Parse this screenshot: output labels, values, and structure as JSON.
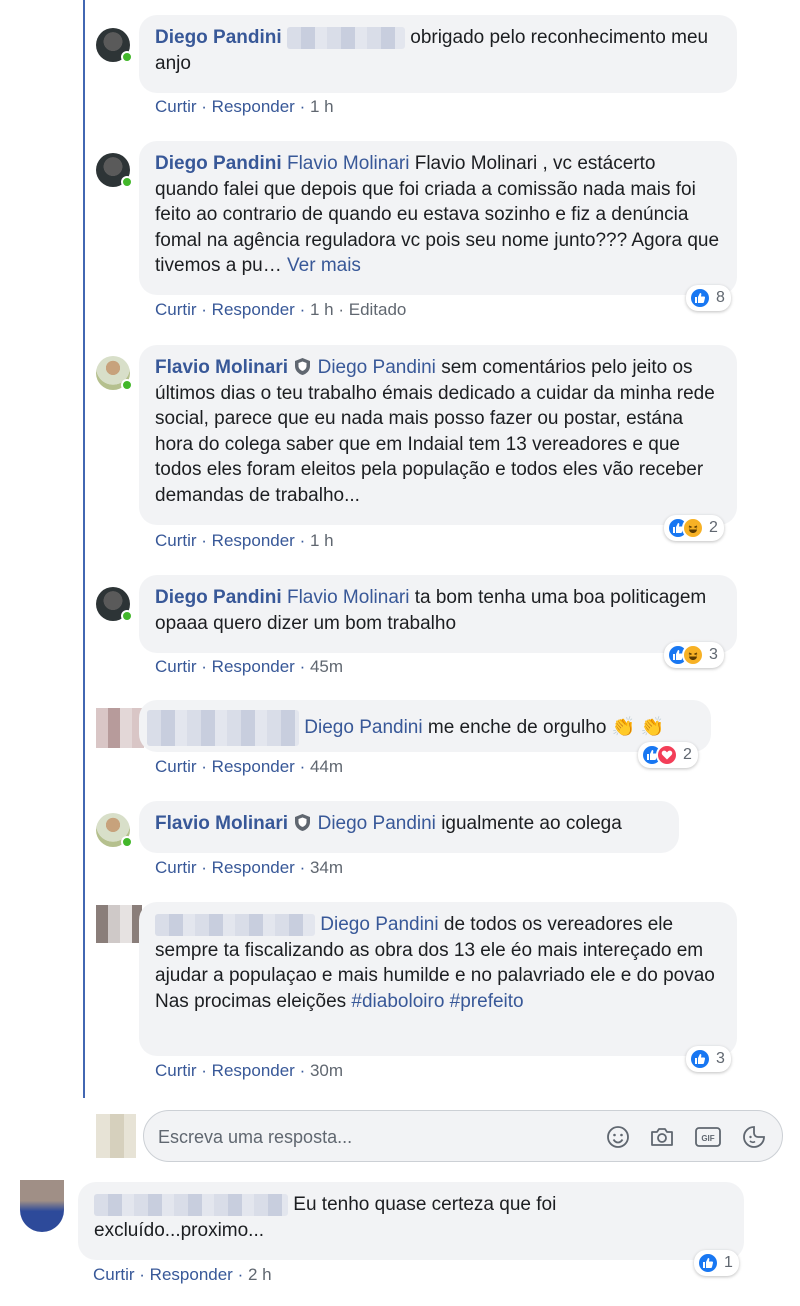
{
  "comments": [
    {
      "author": "Diego Pandini",
      "text": "obrigado pelo reconhecimento meu anjo",
      "actions": {
        "like": "Curtir",
        "reply": "Responder",
        "time": "1 h"
      }
    },
    {
      "author": "Diego Pandini",
      "mention": "Flavio Molinari",
      "text": "Flavio Molinari , vc estácerto quando falei que depois que foi criada a comissão nada mais foi feito ao contrario de quando eu estava sozinho e fiz a denúncia fomal na agência reguladora vc pois seu nome junto??? Agora que tivemos a pu…",
      "see_more": "Ver mais",
      "reactions": "8",
      "actions": {
        "like": "Curtir",
        "reply": "Responder",
        "time": "1 h",
        "edited": "Editado"
      }
    },
    {
      "author": "Flavio Molinari",
      "mention": "Diego Pandini",
      "text": "sem comentários pelo jeito os últimos dias o teu trabalho émais dedicado a cuidar da minha rede social, parece que eu nada mais posso fazer ou postar, estána hora do colega saber que em Indaial tem 13 vereadores e que todos eles foram eleitos pela população e todos eles vão receber demandas de trabalho...",
      "reactions": "2",
      "actions": {
        "like": "Curtir",
        "reply": "Responder",
        "time": "1 h"
      }
    },
    {
      "author": "Diego Pandini",
      "mention": "Flavio Molinari",
      "text": "ta bom tenha uma boa politicagem opaaa quero dizer um bom trabalho",
      "reactions": "3",
      "actions": {
        "like": "Curtir",
        "reply": "Responder",
        "time": "45m"
      }
    },
    {
      "mention": "Diego Pandini",
      "text": "me enche de orgulho",
      "emoji": "👏 👏",
      "reactions": "2",
      "actions": {
        "like": "Curtir",
        "reply": "Responder",
        "time": "44m"
      }
    },
    {
      "author": "Flavio Molinari",
      "mention": "Diego Pandini",
      "text": "igualmente ao colega",
      "actions": {
        "like": "Curtir",
        "reply": "Responder",
        "time": "34m"
      }
    },
    {
      "mention": "Diego Pandini",
      "text": "de todos os vereadores ele sempre ta fiscalizando as obra dos 13 ele éo mais intereçado em ajudar a populaçao e mais humilde e no palavriado ele e do povao",
      "text2": "Nas procimas eleições",
      "hashtags": [
        "#diaboloiro",
        "#prefeito"
      ],
      "reactions": "3",
      "actions": {
        "like": "Curtir",
        "reply": "Responder",
        "time": "30m"
      }
    }
  ],
  "reply_box": {
    "placeholder": "Escreva uma resposta..."
  },
  "bottom_comment": {
    "text": "Eu tenho quase certeza que foi excluído...proximo...",
    "reactions": "1",
    "actions": {
      "like": "Curtir",
      "reply": "Responder",
      "time": "2 h"
    }
  },
  "colors": {
    "link": "#385898",
    "bubble": "#f2f3f5",
    "like": "#1877f2",
    "online": "#42b72a",
    "thread": "#4267b2"
  }
}
